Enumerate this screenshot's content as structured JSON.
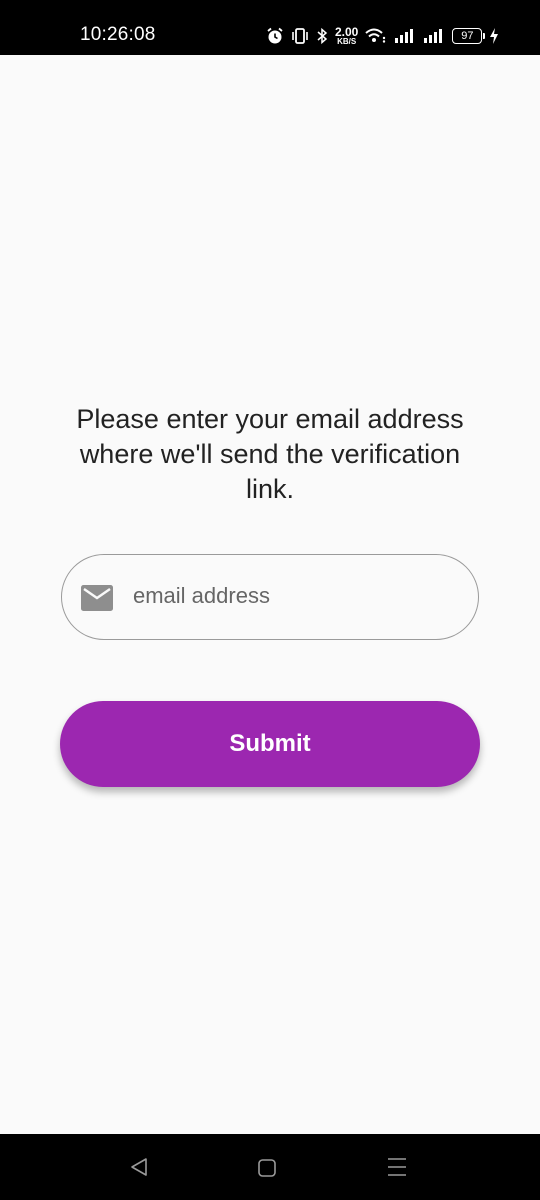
{
  "status_bar": {
    "time": "10:26:08",
    "net_speed_value": "2.00",
    "net_speed_unit": "KB/S",
    "battery_level": "97",
    "icons": [
      "alarm-icon",
      "vibrate-icon",
      "bluetooth-icon",
      "wifi-icon",
      "signal-icon",
      "signal-icon",
      "battery-icon",
      "charging-icon"
    ]
  },
  "main": {
    "prompt": "Please enter your email address where we'll send the verification link.",
    "email_input": {
      "placeholder": "email address",
      "value": "",
      "icon": "mail-icon"
    },
    "submit_label": "Submit"
  },
  "nav_bar": {
    "icons": [
      "back-icon",
      "home-icon",
      "recents-icon"
    ]
  },
  "colors": {
    "accent": "#9c27b0",
    "background": "#fafafa",
    "text": "#222222",
    "icon": "#8e8e8e"
  }
}
